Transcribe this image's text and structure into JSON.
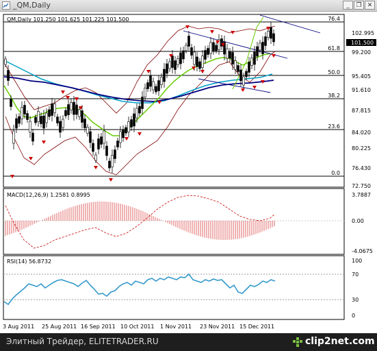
{
  "window": {
    "title": "_QM,Daily",
    "buttons": {
      "minimize": "_",
      "restore": "❐",
      "close": "✕"
    }
  },
  "main_chart": {
    "header": "QM,Daily  101.250 101.625 101.225 101.500",
    "price_labels": [
      "102.995",
      "99.200",
      "95.405",
      "91.610",
      "87.815",
      "84.020",
      "80.225",
      "76.430",
      "72.750"
    ],
    "current_price": "101.500",
    "fib_levels": [
      "76.4",
      "61.8",
      "50.0",
      "38.2",
      "23.6",
      "0.0"
    ]
  },
  "macd": {
    "header": "MACD(12,26,9) 1.2581 0.8995",
    "labels": [
      "3.7887",
      "0.00",
      "-4.0675"
    ]
  },
  "rsi": {
    "header": "RSI(14) 56.8732",
    "labels": [
      "100",
      "70",
      "30",
      "0"
    ]
  },
  "time_axis": [
    "3 Aug 2011",
    "25 Aug 2011",
    "16 Sep 2011",
    "10 Oct 2011",
    "1 Nov 2011",
    "23 Nov 2011",
    "15 Dec 2011"
  ],
  "footer": {
    "text": "Элитный Трейдер, ELITETRADER.RU",
    "brand": "clip2net.com"
  },
  "colors": {
    "background": "#ffffff",
    "candles": "#000000",
    "bollinger": "#800000",
    "ma_fast": "#66cc00",
    "ma_slow": "#00a0c8",
    "ma_long": "#000080",
    "fractals": "#cc0000",
    "rsi_line": "#3399cc",
    "macd_hist": "#cc0000"
  },
  "icons": [
    "app-chart-icon",
    "minimize-icon",
    "restore-icon",
    "close-icon",
    "clip2net-logo-icon"
  ]
}
